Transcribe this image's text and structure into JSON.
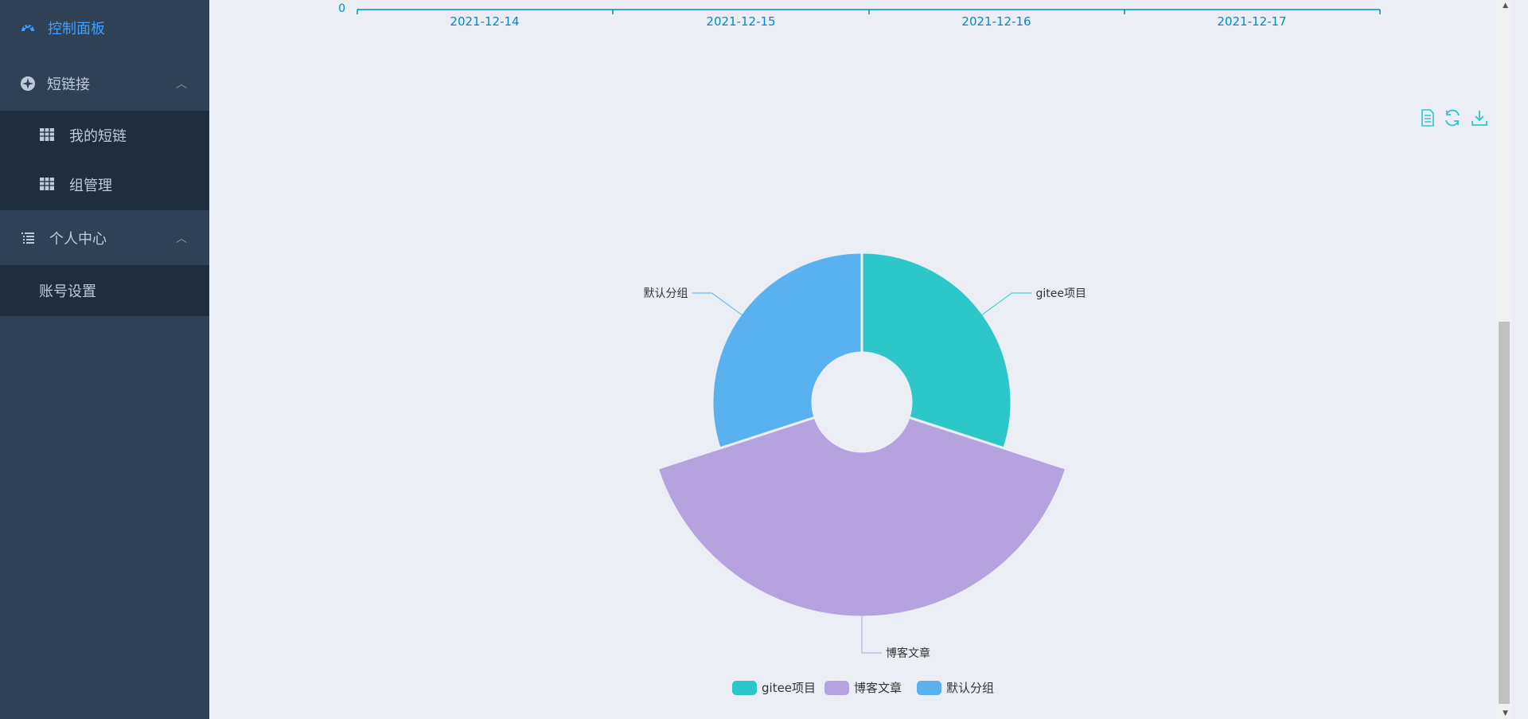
{
  "sidebar": {
    "items": [
      {
        "label": "控制面板",
        "icon": "dashboard-icon",
        "active": true
      },
      {
        "label": "短链接",
        "icon": "link-icon",
        "expanded": true,
        "children": [
          {
            "label": "我的短链",
            "icon": "table-icon"
          },
          {
            "label": "组管理",
            "icon": "table-icon"
          }
        ]
      },
      {
        "label": "个人中心",
        "icon": "list-icon",
        "expanded": true,
        "children": [
          {
            "label": "账号设置"
          }
        ]
      }
    ]
  },
  "timeline_axis": {
    "zero_label": "0",
    "dates": [
      "2021-12-14",
      "2021-12-15",
      "2021-12-16",
      "2021-12-17"
    ]
  },
  "toolbox": {
    "icons": [
      "data-view-icon",
      "restore-icon",
      "save-image-icon"
    ]
  },
  "chart_data": {
    "type": "pie",
    "subtype": "rose",
    "categories": [
      "gitee项目",
      "博客文章",
      "默认分组"
    ],
    "series": [
      {
        "values": [
          30,
          40,
          30
        ]
      }
    ],
    "colors": [
      "#2ec7c9",
      "#b6a2de",
      "#5ab1ef"
    ],
    "legend": [
      "gitee项目",
      "博客文章",
      "默认分组"
    ],
    "legend_position": "bottom"
  }
}
